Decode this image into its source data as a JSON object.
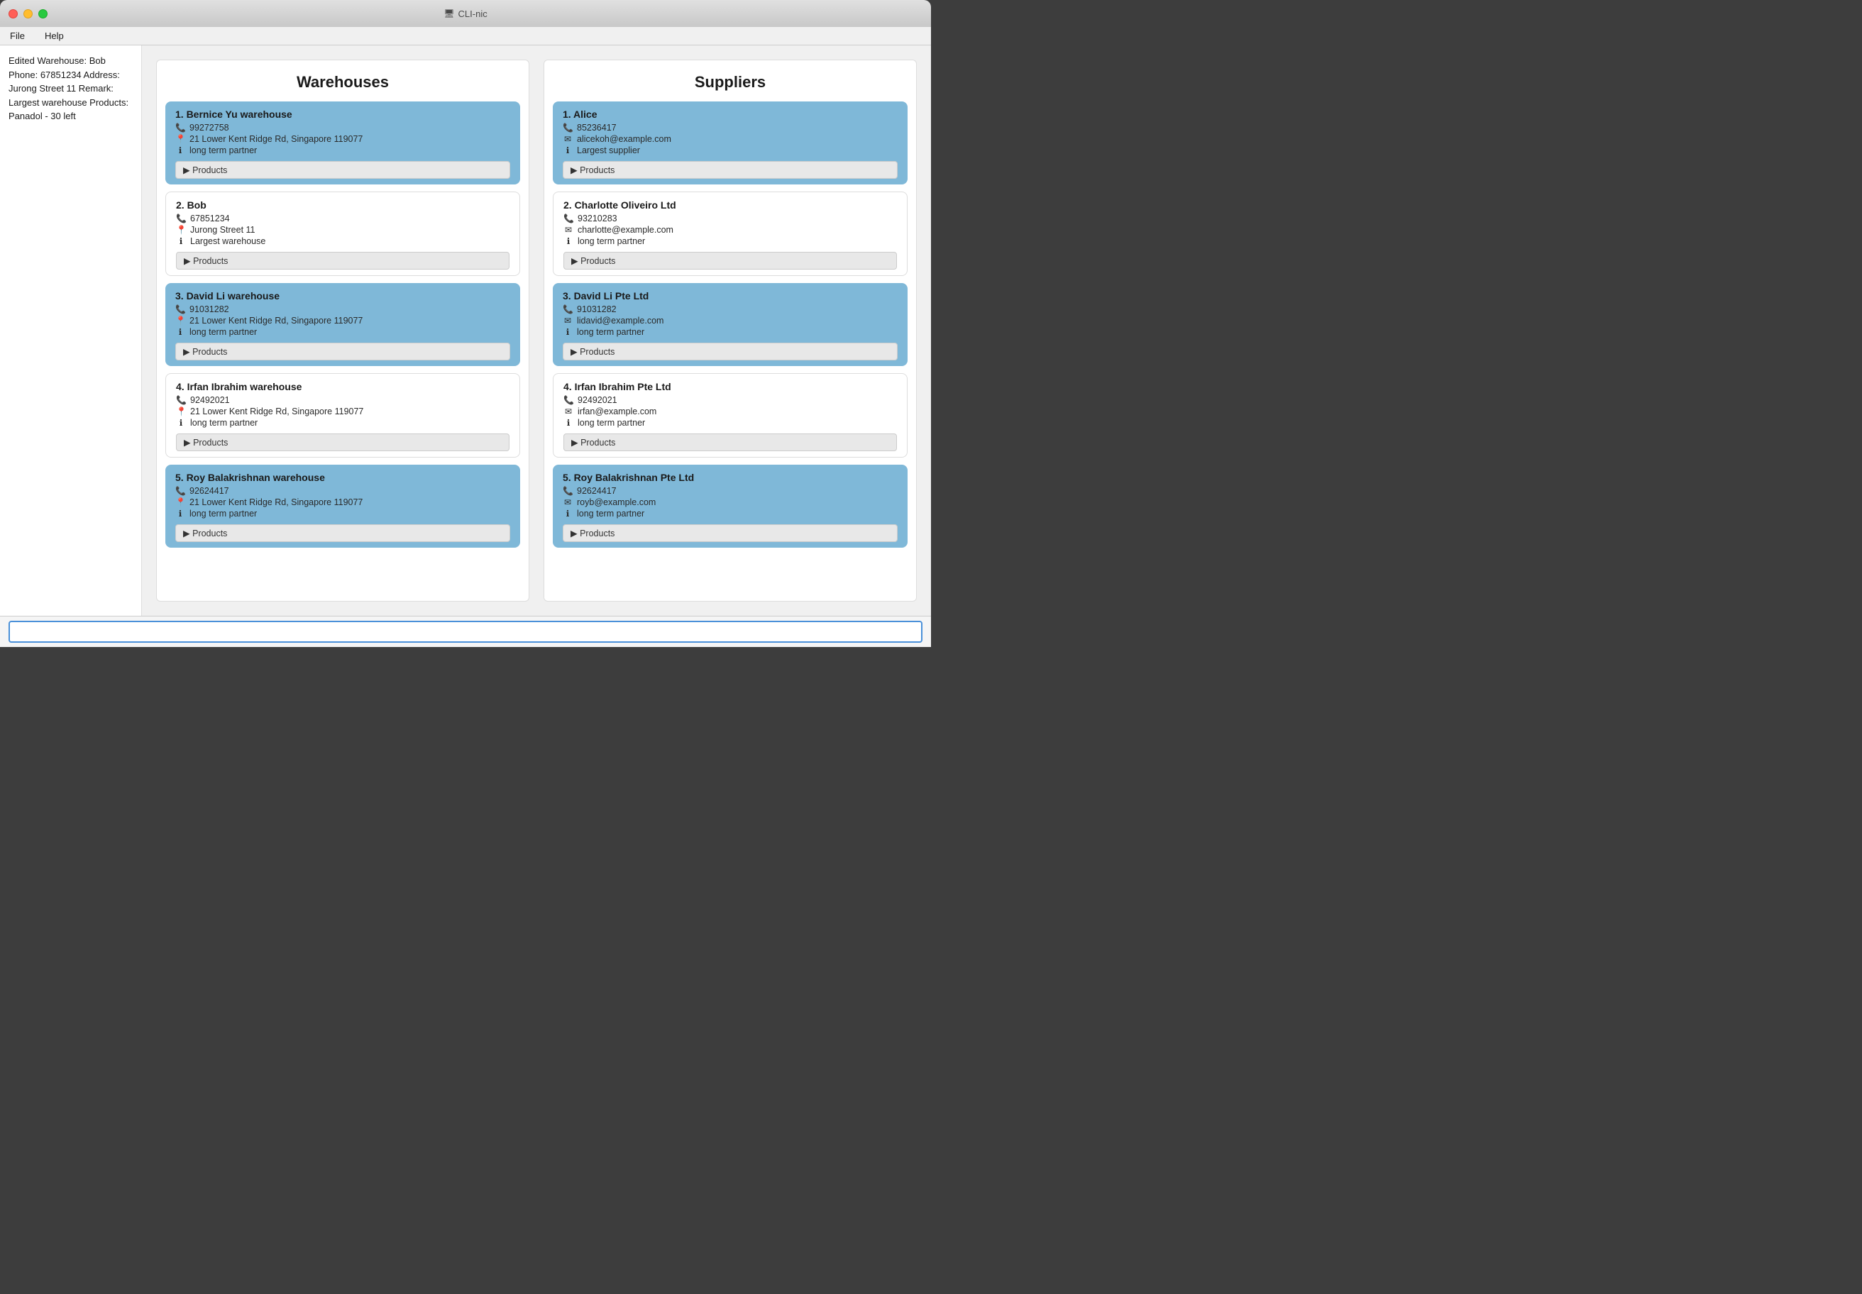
{
  "window": {
    "title": "CLI-nic",
    "title_icon": "🖥"
  },
  "menu": {
    "items": [
      {
        "label": "File"
      },
      {
        "label": "Help"
      }
    ]
  },
  "sidebar": {
    "text": "Edited Warehouse: Bob Phone: 67851234 Address: Jurong Street 11 Remark: Largest warehouse Products: Panadol - 30 left"
  },
  "warehouses": {
    "title": "Warehouses",
    "items": [
      {
        "index": "1.",
        "name": "Bernice Yu warehouse",
        "phone": "99272758",
        "address": "21 Lower Kent Ridge Rd, Singapore 119077",
        "remark": "long term partner",
        "highlighted": true
      },
      {
        "index": "2.",
        "name": "Bob",
        "phone": "67851234",
        "address": "Jurong Street 11",
        "remark": "Largest warehouse",
        "highlighted": false
      },
      {
        "index": "3.",
        "name": "David Li warehouse",
        "phone": "91031282",
        "address": "21 Lower Kent Ridge Rd, Singapore 119077",
        "remark": "long term partner",
        "highlighted": true
      },
      {
        "index": "4.",
        "name": "Irfan Ibrahim warehouse",
        "phone": "92492021",
        "address": "21 Lower Kent Ridge Rd, Singapore 119077",
        "remark": "long term partner",
        "highlighted": false
      },
      {
        "index": "5.",
        "name": "Roy Balakrishnan warehouse",
        "phone": "92624417",
        "address": "21 Lower Kent Ridge Rd, Singapore 119077",
        "remark": "long term partner",
        "highlighted": true
      }
    ],
    "products_label": "▶  Products"
  },
  "suppliers": {
    "title": "Suppliers",
    "items": [
      {
        "index": "1.",
        "name": "Alice",
        "phone": "85236417",
        "email": "alicekoh@example.com",
        "remark": "Largest supplier",
        "highlighted": true
      },
      {
        "index": "2.",
        "name": "Charlotte Oliveiro Ltd",
        "phone": "93210283",
        "email": "charlotte@example.com",
        "remark": "long term partner",
        "highlighted": false
      },
      {
        "index": "3.",
        "name": "David Li Pte Ltd",
        "phone": "91031282",
        "email": "lidavid@example.com",
        "remark": "long term partner",
        "highlighted": true
      },
      {
        "index": "4.",
        "name": "Irfan Ibrahim Pte Ltd",
        "phone": "92492021",
        "email": "irfan@example.com",
        "remark": "long term partner",
        "highlighted": false
      },
      {
        "index": "5.",
        "name": "Roy Balakrishnan Pte Ltd",
        "phone": "92624417",
        "email": "royb@example.com",
        "remark": "long term partner",
        "highlighted": true
      }
    ],
    "products_label": "▶  Products"
  },
  "bottom_input": {
    "placeholder": "",
    "value": ""
  }
}
